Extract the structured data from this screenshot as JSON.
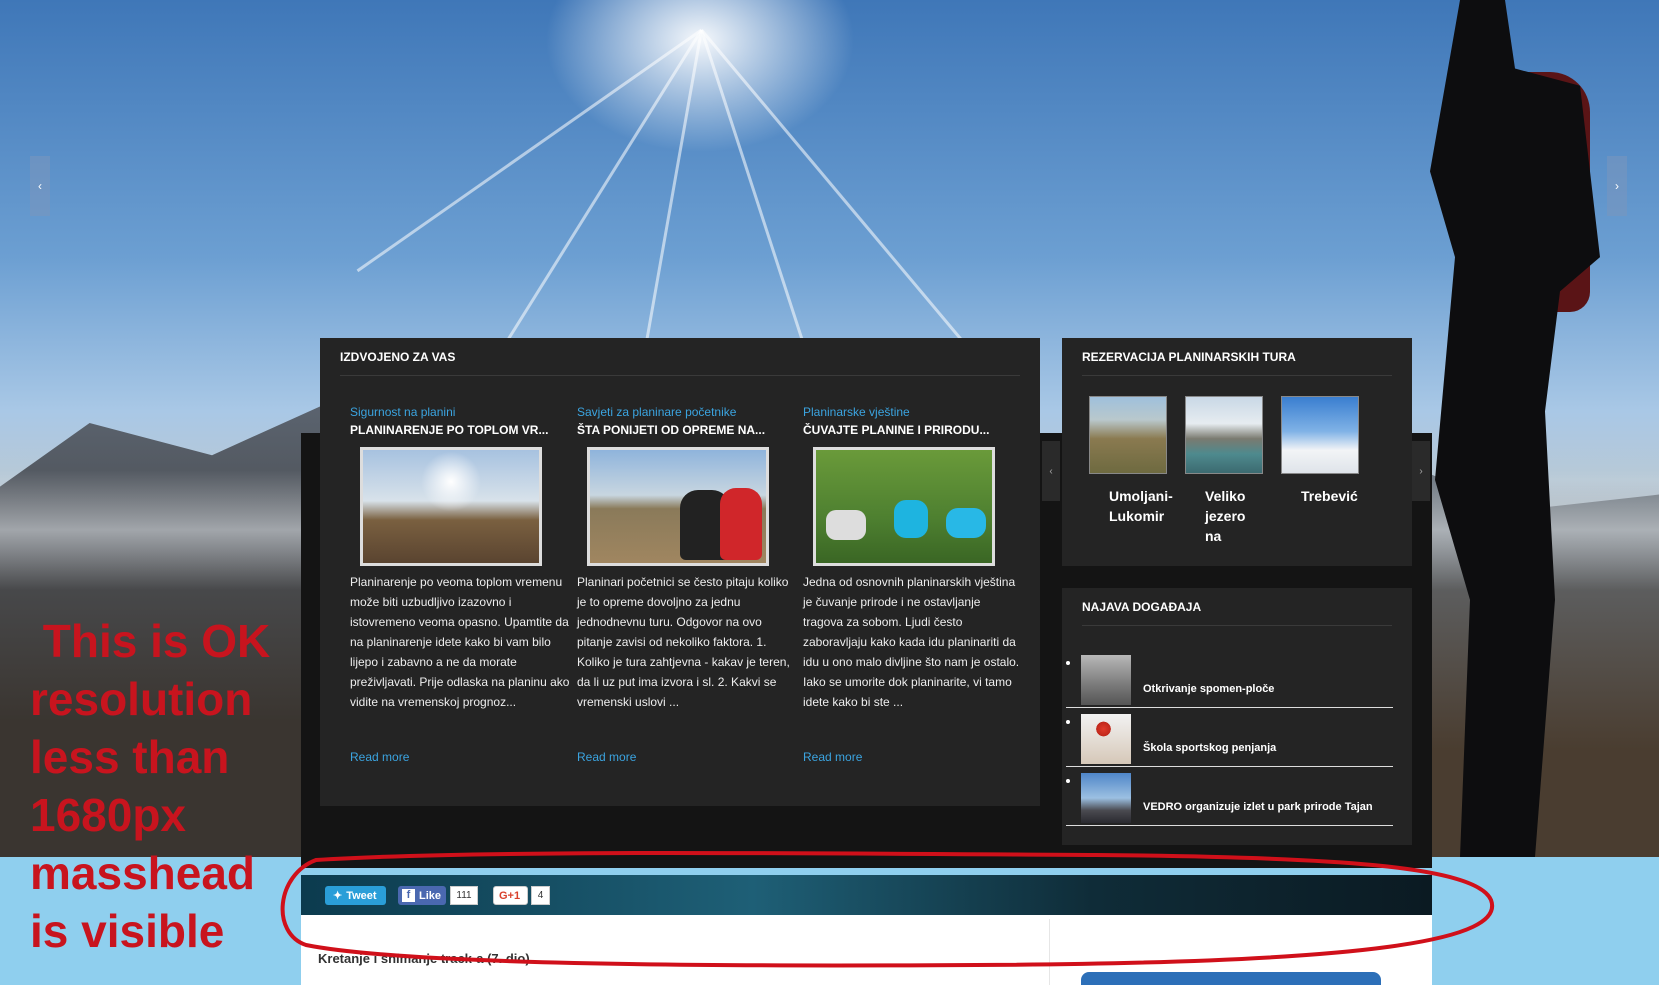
{
  "featured": {
    "title": "IZDVOJENO ZA VAS",
    "read_more": "Read more",
    "articles": [
      {
        "category": "Sigurnost na planini",
        "title": "PLANINARENJE PO TOPLOM VR...",
        "text": "Planinarenje po veoma toplom vremenu može biti uzbudljivo izazovno i istovremeno veoma opasno. Upamtite da na planinarenje idete kako bi vam bilo lijepo i zabavno a ne da morate preživljavati. Prije odlaska na planinu ako vidite na vremenskoj prognoz..."
      },
      {
        "category": "Savjeti za planinare početnike",
        "title": "ŠTA PONIJETI OD OPREME NA...",
        "text": "Planinari početnici se često pitaju koliko je to opreme dovoljno za jednu jednodnevnu turu. Odgovor na ovo pitanje zavisi od nekoliko faktora. 1. Koliko je tura zahtjevna - kakav je teren, da li uz put ima izvora i sl. 2. Kakvi se vremenski uslovi ..."
      },
      {
        "category": "Planinarske vještine",
        "title": "ČUVAJTE PLANINE I PRIRODU...",
        "text": "Jedna od osnovnih planinarskih vještina je čuvanje prirode i ne ostavljanje tragova za sobom. Ljudi često zaboravljaju kako kada idu planinariti da idu u ono malo divljine što nam je ostalo. Iako se umorite dok planinarite, vi tamo idete kako bi ste ..."
      }
    ]
  },
  "tours": {
    "title": "REZERVACIJA PLANINARSKIH TURA",
    "items": [
      {
        "name": "Umoljani-Lukomir"
      },
      {
        "name": "Veliko jezero na"
      },
      {
        "name": "Trebević"
      }
    ]
  },
  "events": {
    "title": "NAJAVA DOGAĐAJA",
    "items": [
      {
        "title": "Otkrivanje spomen-ploče"
      },
      {
        "title": "Škola sportskog penjanja"
      },
      {
        "title": "VEDRO organizuje izlet u park prirode Tajan"
      }
    ]
  },
  "share": {
    "tweet_label": "Tweet",
    "like_label": "Like",
    "like_count": "111",
    "gplus_label": "G+1",
    "gplus_count": "4"
  },
  "content": {
    "post_title": "Kretanje i snimanje track-a (7. dio)"
  },
  "annotation": {
    "text": " This is OK\nresolution\nless than\n1680px\nmasshead\nis visible"
  },
  "colors": {
    "accent_link": "#3ba4e0",
    "annotation_red": "#c8141e",
    "panel_bg": "#242424",
    "sky_band": "#8fcfee"
  },
  "icons": {
    "slider_prev": "chevron-left-icon",
    "slider_next": "chevron-right-icon",
    "tweet": "twitter-bird-icon",
    "like": "facebook-icon"
  }
}
